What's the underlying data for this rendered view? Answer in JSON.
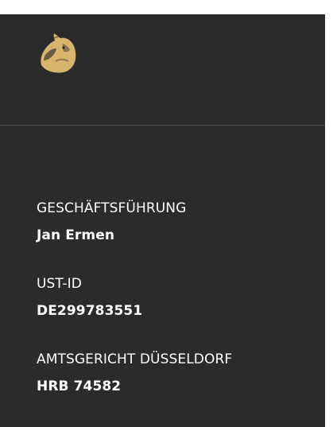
{
  "colors": {
    "panel_bg": "#2b2b2b",
    "text": "#ffffff",
    "logo_gold": "#d7b56d"
  },
  "logo": {
    "icon": "horse-head-icon"
  },
  "company_info": {
    "management_label": "GESCHÄFTSFÜHRUNG",
    "management_value": "Jan Ermen",
    "vat_label": "UST-ID",
    "vat_value": "DE299783551",
    "court_label": "AMTSGERICHT DÜSSELDORF",
    "court_value": "HRB 74582"
  }
}
